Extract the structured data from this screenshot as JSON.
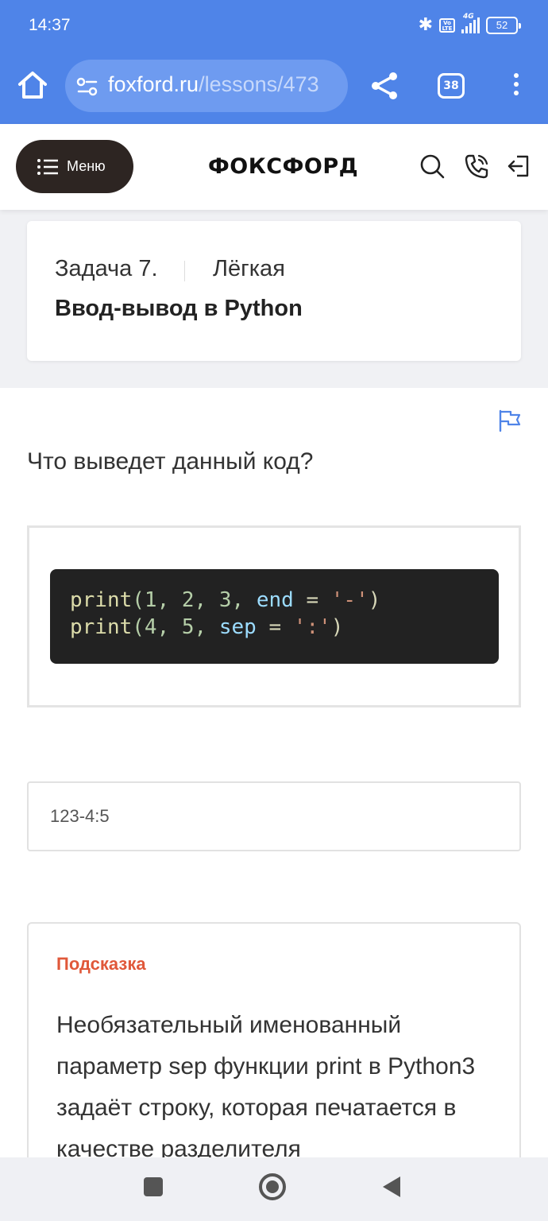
{
  "status_bar": {
    "time": "14:37",
    "network": "4G",
    "volte": "Vo LTE",
    "battery": "52"
  },
  "browser": {
    "url_domain": "foxford.ru",
    "url_path": "/lessons/473",
    "tab_count": "38"
  },
  "site_header": {
    "menu_label": "Меню",
    "logo": "ФОКСФОРД"
  },
  "task": {
    "number": "Задача 7.",
    "difficulty": "Лёгкая",
    "title": "Ввод-вывод в Python"
  },
  "question": "Что выведет данный код?",
  "code": {
    "line1": {
      "fn": "print",
      "args": "(1, 2, 3, ",
      "kw": "end",
      "op": " = ",
      "str": "'-'",
      "close": ")"
    },
    "line2": {
      "fn": "print",
      "args": "(4, 5, ",
      "kw": "sep",
      "op": " = ",
      "str": "':'",
      "close": ")"
    }
  },
  "answer": {
    "value": "123-4:5"
  },
  "hint": {
    "label": "Подсказка",
    "text": "Необязательный именованный параметр sep функции print в Python3 задаёт строку, которая печатается в качестве разделителя"
  },
  "colors": {
    "browser_bar": "#4f84e8",
    "hint_label": "#e0583a",
    "menu_button": "#2d2522",
    "code_background": "#222222"
  }
}
